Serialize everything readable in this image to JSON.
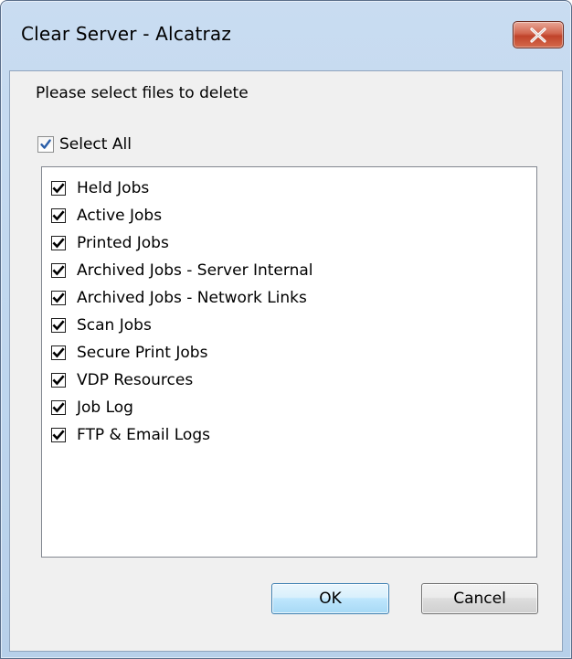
{
  "window": {
    "title": "Clear Server - Alcatraz",
    "close_icon": "close-x-icon"
  },
  "dialog": {
    "prompt": "Please select files to delete",
    "select_all": {
      "label": "Select All",
      "checked": true
    },
    "items": [
      {
        "label": "Held Jobs",
        "checked": true
      },
      {
        "label": "Active Jobs",
        "checked": true
      },
      {
        "label": "Printed Jobs",
        "checked": true
      },
      {
        "label": "Archived Jobs - Server Internal",
        "checked": true
      },
      {
        "label": "Archived Jobs - Network Links",
        "checked": true
      },
      {
        "label": "Scan Jobs",
        "checked": true
      },
      {
        "label": "Secure Print Jobs",
        "checked": true
      },
      {
        "label": "VDP Resources",
        "checked": true
      },
      {
        "label": "Job Log",
        "checked": true
      },
      {
        "label": "FTP & Email Logs",
        "checked": true
      }
    ],
    "buttons": {
      "ok": "OK",
      "cancel": "Cancel"
    }
  },
  "colors": {
    "frame": "#bed6ee",
    "client": "#f0f0f0",
    "close_button": "#c9462c",
    "ok_border": "#3c7fb1"
  }
}
